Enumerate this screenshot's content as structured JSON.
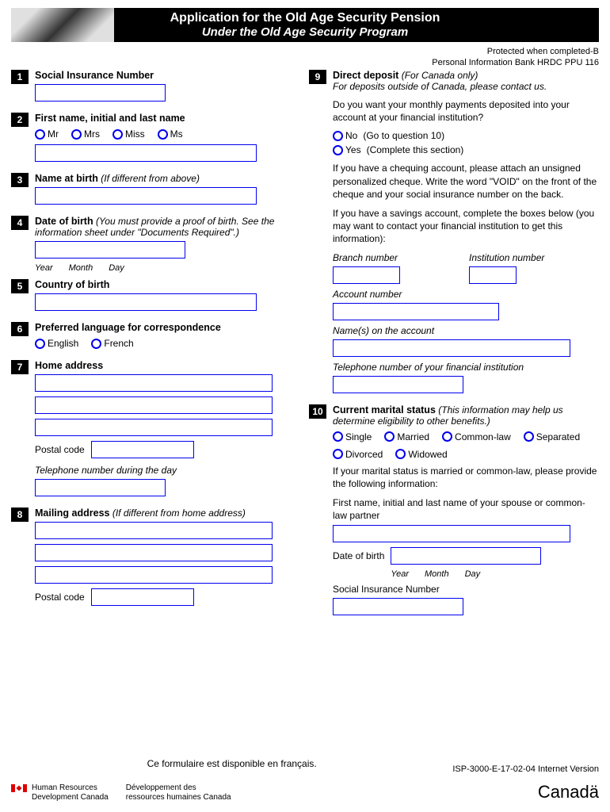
{
  "header": {
    "title": "Application for the Old Age Security Pension",
    "subtitle": "Under the Old Age Security Program"
  },
  "protected": {
    "line1": "Protected when completed-B",
    "line2": "Personal Information Bank HRDC PPU 116"
  },
  "q1": {
    "num": "1",
    "label": "Social Insurance Number"
  },
  "q2": {
    "num": "2",
    "label": "First name, initial and last name",
    "opts": {
      "mr": "Mr",
      "mrs": "Mrs",
      "miss": "Miss",
      "ms": "Ms"
    }
  },
  "q3": {
    "num": "3",
    "label": "Name at birth",
    "hint": "(If different from above)"
  },
  "q4": {
    "num": "4",
    "label": "Date of birth",
    "hint": "(You must provide a proof of birth. See the information sheet under \"Documents Required\".)",
    "year": "Year",
    "month": "Month",
    "day": "Day"
  },
  "q5": {
    "num": "5",
    "label": "Country of birth"
  },
  "q6": {
    "num": "6",
    "label": "Preferred language for correspondence",
    "english": "English",
    "french": "French"
  },
  "q7": {
    "num": "7",
    "label": "Home address",
    "postal": "Postal code",
    "phone": "Telephone number during the day"
  },
  "q8": {
    "num": "8",
    "label": "Mailing address",
    "hint": "(If different from home address)",
    "postal": "Postal code"
  },
  "q9": {
    "num": "9",
    "label": "Direct deposit",
    "hint": "(For Canada only)",
    "sub": "For deposits outside of Canada, please contact us.",
    "question": "Do you want your monthly payments deposited into your account at your financial institution?",
    "no": "No",
    "no_hint": "(Go to question 10)",
    "yes": "Yes",
    "yes_hint": "(Complete this section)",
    "chequing": "If you have a chequing account, please attach an unsigned personalized cheque. Write the word \"VOID\" on the front of the cheque and your social insurance number on the back.",
    "savings": "If you have a savings account, complete the boxes below (you may want to contact your financial institution to get this information):",
    "branch": "Branch number",
    "institution": "Institution number",
    "account": "Account number",
    "names": "Name(s) on the account",
    "fi_phone": "Telephone number of your financial institution"
  },
  "q10": {
    "num": "10",
    "label": "Current marital status",
    "hint": "(This information may help us determine eligibility to other benefits.)",
    "single": "Single",
    "married": "Married",
    "commonlaw": "Common-law",
    "separated": "Separated",
    "divorced": "Divorced",
    "widowed": "Widowed",
    "if_married": "If your marital status is married or common-law, please provide the following information:",
    "spouse_name": "First name, initial and last name of your spouse or common-law partner",
    "dob": "Date of birth",
    "year": "Year",
    "month": "Month",
    "day": "Day",
    "sin": "Social Insurance Number"
  },
  "footer": {
    "french_note": "Ce formulaire est disponible en français.",
    "form_code": "ISP-3000-E-17-02-04  Internet Version",
    "dept_en1": "Human Resources",
    "dept_en2": "Development Canada",
    "dept_fr1": "Développement des",
    "dept_fr2": "ressources humaines Canada",
    "wordmark": "Canadä"
  }
}
